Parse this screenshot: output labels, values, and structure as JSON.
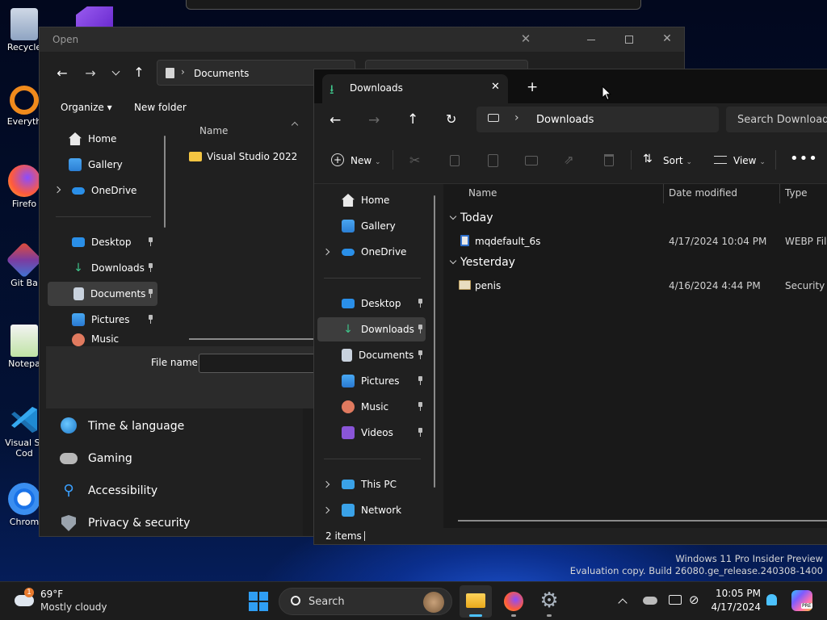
{
  "desktop": {
    "icons": [
      "Recycle",
      "Everyth",
      "Firefo",
      "Git Ba",
      "Notepa",
      "Visual St\nCod",
      "Chrom"
    ],
    "watermark_line1": "Windows 11 Pro Insider Preview",
    "watermark_line2": "Evaluation copy. Build 26080.ge_release.240308-1400"
  },
  "open_dialog": {
    "title": "Open",
    "address_text": "Documents",
    "organize_label": "Organize",
    "new_folder_label": "New folder",
    "column_name": "Name",
    "files": [
      "Visual Studio 2022"
    ],
    "nav_items": [
      "Home",
      "Gallery",
      "OneDrive",
      "Desktop",
      "Downloads",
      "Documents",
      "Pictures",
      "Music"
    ],
    "file_name_label": "File name:"
  },
  "settings_window": {
    "items": [
      "Time & language",
      "Gaming",
      "Accessibility",
      "Privacy & security"
    ]
  },
  "explorer": {
    "tab_title": "Downloads",
    "address_text": "Downloads",
    "search_placeholder": "Search Downloads",
    "toolbar": {
      "new_label": "New",
      "sort_label": "Sort",
      "view_label": "View"
    },
    "columns": {
      "name": "Name",
      "date": "Date modified",
      "type": "Type"
    },
    "groups": [
      {
        "label": "Today",
        "files": [
          {
            "name": "mqdefault_6s",
            "date": "4/17/2024 10:04 PM",
            "type": "WEBP File"
          }
        ]
      },
      {
        "label": "Yesterday",
        "files": [
          {
            "name": "penis",
            "date": "4/16/2024 4:44 PM",
            "type": "Security C"
          }
        ]
      }
    ],
    "nav_items": [
      "Home",
      "Gallery",
      "OneDrive",
      "Desktop",
      "Downloads",
      "Documents",
      "Pictures",
      "Music",
      "Videos",
      "This PC",
      "Network"
    ],
    "status_text": "2 items"
  },
  "taskbar": {
    "weather_temp": "69°F",
    "weather_desc": "Mostly cloudy",
    "weather_badge": "1",
    "search_label": "Search",
    "time": "10:05 PM",
    "date": "4/17/2024",
    "copilot_badge": "PRE"
  },
  "colors": {
    "accent": "#4cc2ff",
    "window_bg": "#202020",
    "selected": "#3d3d3d"
  }
}
